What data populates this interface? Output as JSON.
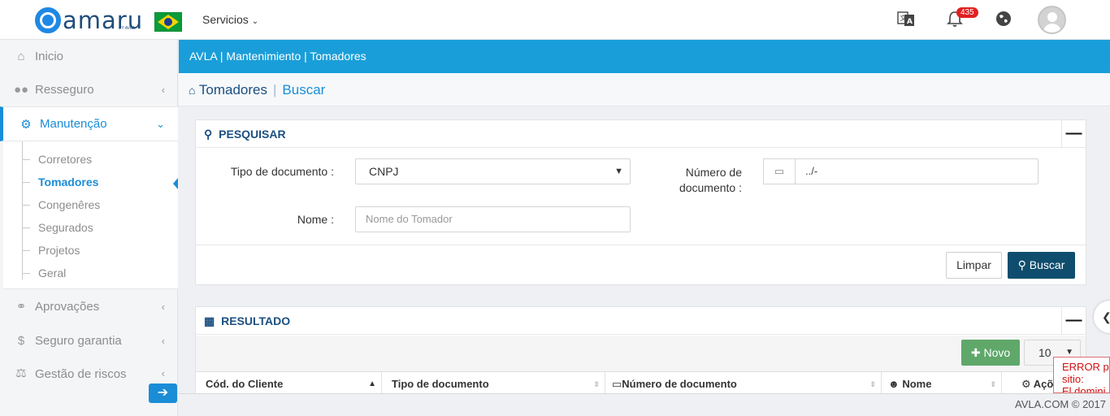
{
  "header": {
    "brand": "amaru",
    "brand_sub": "BY AVLA",
    "menu": "Servicios",
    "notifications": "435"
  },
  "sidebar": {
    "items": [
      {
        "label": "Inicio",
        "icon": "home-icon"
      },
      {
        "label": "Resseguro",
        "icon": "users-icon"
      },
      {
        "label": "Manutenção",
        "icon": "gear-icon"
      },
      {
        "label": "Aprovações",
        "icon": "handshake-icon"
      },
      {
        "label": "Seguro garantia",
        "icon": "dollar-icon"
      },
      {
        "label": "Gestão de riscos",
        "icon": "scale-icon"
      }
    ],
    "submenu": [
      "Corretores",
      "Tomadores",
      "Congenêres",
      "Segurados",
      "Projetos",
      "Geral"
    ]
  },
  "breadcrumb": "AVLA | Mantenimiento | Tomadores",
  "page": {
    "title": "Tomadores",
    "sep": "|",
    "subtitle": "Buscar"
  },
  "search": {
    "title": "PESQUISAR",
    "doc_type_label": "Tipo de documento :",
    "doc_type_value": "CNPJ",
    "doc_num_label_1": "Número de",
    "doc_num_label_2": "documento :",
    "doc_num_value": "../-",
    "name_label": "Nome :",
    "name_placeholder": "Nome  do  Tomador",
    "clear": "Limpar",
    "search": "Buscar"
  },
  "result": {
    "title": "RESULTADO",
    "new": "Novo",
    "per_page": "10",
    "columns": [
      "Cód. do Cliente",
      "Tipo de documento",
      "Número de documento",
      "Nome",
      "Açõ"
    ]
  },
  "error": {
    "line1": "ERROR pa",
    "line2": "sitio:",
    "line3": "El domini"
  },
  "footer": "AVLA.COM © 2017",
  "colors": {
    "primary": "#1a9ed9",
    "dark": "#0f4d6e",
    "success": "#5fa86a"
  }
}
